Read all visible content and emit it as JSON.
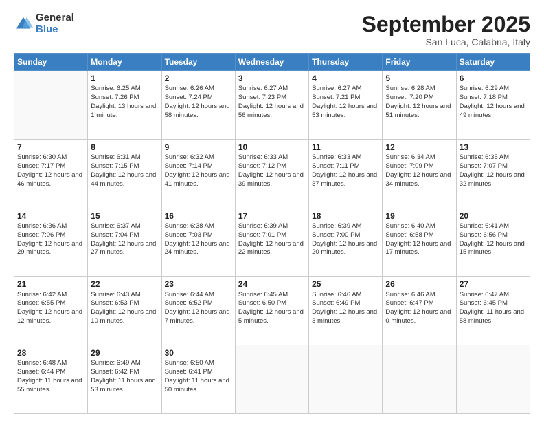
{
  "logo": {
    "general": "General",
    "blue": "Blue"
  },
  "title": {
    "month": "September 2025",
    "location": "San Luca, Calabria, Italy"
  },
  "weekdays": [
    "Sunday",
    "Monday",
    "Tuesday",
    "Wednesday",
    "Thursday",
    "Friday",
    "Saturday"
  ],
  "weeks": [
    [
      {
        "day": "",
        "content": ""
      },
      {
        "day": "1",
        "content": "Sunrise: 6:25 AM\nSunset: 7:26 PM\nDaylight: 13 hours and 1 minute."
      },
      {
        "day": "2",
        "content": "Sunrise: 6:26 AM\nSunset: 7:24 PM\nDaylight: 12 hours and 58 minutes."
      },
      {
        "day": "3",
        "content": "Sunrise: 6:27 AM\nSunset: 7:23 PM\nDaylight: 12 hours and 56 minutes."
      },
      {
        "day": "4",
        "content": "Sunrise: 6:27 AM\nSunset: 7:21 PM\nDaylight: 12 hours and 53 minutes."
      },
      {
        "day": "5",
        "content": "Sunrise: 6:28 AM\nSunset: 7:20 PM\nDaylight: 12 hours and 51 minutes."
      },
      {
        "day": "6",
        "content": "Sunrise: 6:29 AM\nSunset: 7:18 PM\nDaylight: 12 hours and 49 minutes."
      }
    ],
    [
      {
        "day": "7",
        "content": "Sunrise: 6:30 AM\nSunset: 7:17 PM\nDaylight: 12 hours and 46 minutes."
      },
      {
        "day": "8",
        "content": "Sunrise: 6:31 AM\nSunset: 7:15 PM\nDaylight: 12 hours and 44 minutes."
      },
      {
        "day": "9",
        "content": "Sunrise: 6:32 AM\nSunset: 7:14 PM\nDaylight: 12 hours and 41 minutes."
      },
      {
        "day": "10",
        "content": "Sunrise: 6:33 AM\nSunset: 7:12 PM\nDaylight: 12 hours and 39 minutes."
      },
      {
        "day": "11",
        "content": "Sunrise: 6:33 AM\nSunset: 7:11 PM\nDaylight: 12 hours and 37 minutes."
      },
      {
        "day": "12",
        "content": "Sunrise: 6:34 AM\nSunset: 7:09 PM\nDaylight: 12 hours and 34 minutes."
      },
      {
        "day": "13",
        "content": "Sunrise: 6:35 AM\nSunset: 7:07 PM\nDaylight: 12 hours and 32 minutes."
      }
    ],
    [
      {
        "day": "14",
        "content": "Sunrise: 6:36 AM\nSunset: 7:06 PM\nDaylight: 12 hours and 29 minutes."
      },
      {
        "day": "15",
        "content": "Sunrise: 6:37 AM\nSunset: 7:04 PM\nDaylight: 12 hours and 27 minutes."
      },
      {
        "day": "16",
        "content": "Sunrise: 6:38 AM\nSunset: 7:03 PM\nDaylight: 12 hours and 24 minutes."
      },
      {
        "day": "17",
        "content": "Sunrise: 6:39 AM\nSunset: 7:01 PM\nDaylight: 12 hours and 22 minutes."
      },
      {
        "day": "18",
        "content": "Sunrise: 6:39 AM\nSunset: 7:00 PM\nDaylight: 12 hours and 20 minutes."
      },
      {
        "day": "19",
        "content": "Sunrise: 6:40 AM\nSunset: 6:58 PM\nDaylight: 12 hours and 17 minutes."
      },
      {
        "day": "20",
        "content": "Sunrise: 6:41 AM\nSunset: 6:56 PM\nDaylight: 12 hours and 15 minutes."
      }
    ],
    [
      {
        "day": "21",
        "content": "Sunrise: 6:42 AM\nSunset: 6:55 PM\nDaylight: 12 hours and 12 minutes."
      },
      {
        "day": "22",
        "content": "Sunrise: 6:43 AM\nSunset: 6:53 PM\nDaylight: 12 hours and 10 minutes."
      },
      {
        "day": "23",
        "content": "Sunrise: 6:44 AM\nSunset: 6:52 PM\nDaylight: 12 hours and 7 minutes."
      },
      {
        "day": "24",
        "content": "Sunrise: 6:45 AM\nSunset: 6:50 PM\nDaylight: 12 hours and 5 minutes."
      },
      {
        "day": "25",
        "content": "Sunrise: 6:46 AM\nSunset: 6:49 PM\nDaylight: 12 hours and 3 minutes."
      },
      {
        "day": "26",
        "content": "Sunrise: 6:46 AM\nSunset: 6:47 PM\nDaylight: 12 hours and 0 minutes."
      },
      {
        "day": "27",
        "content": "Sunrise: 6:47 AM\nSunset: 6:45 PM\nDaylight: 11 hours and 58 minutes."
      }
    ],
    [
      {
        "day": "28",
        "content": "Sunrise: 6:48 AM\nSunset: 6:44 PM\nDaylight: 11 hours and 55 minutes."
      },
      {
        "day": "29",
        "content": "Sunrise: 6:49 AM\nSunset: 6:42 PM\nDaylight: 11 hours and 53 minutes."
      },
      {
        "day": "30",
        "content": "Sunrise: 6:50 AM\nSunset: 6:41 PM\nDaylight: 11 hours and 50 minutes."
      },
      {
        "day": "",
        "content": ""
      },
      {
        "day": "",
        "content": ""
      },
      {
        "day": "",
        "content": ""
      },
      {
        "day": "",
        "content": ""
      }
    ]
  ]
}
